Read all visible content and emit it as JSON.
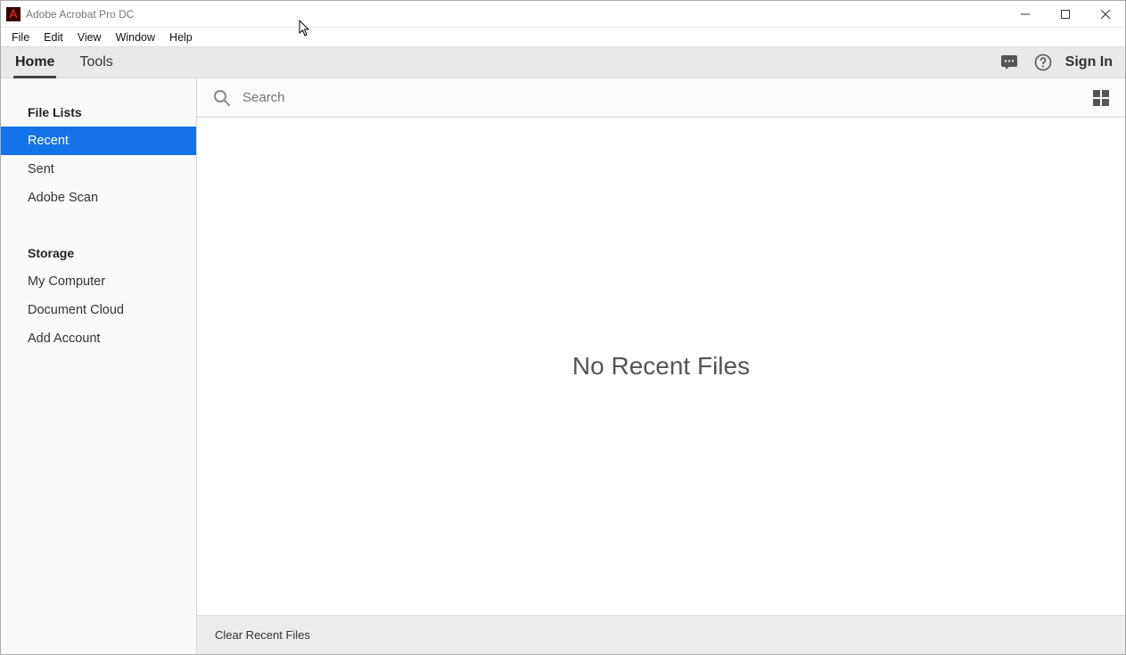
{
  "window": {
    "title": "Adobe Acrobat Pro DC"
  },
  "menubar": {
    "file": "File",
    "edit": "Edit",
    "view": "View",
    "window": "Window",
    "help": "Help"
  },
  "tabs": {
    "home": "Home",
    "tools": "Tools",
    "sign_in": "Sign In"
  },
  "sidebar": {
    "file_lists_header": "File Lists",
    "recent": "Recent",
    "sent": "Sent",
    "adobe_scan": "Adobe Scan",
    "storage_header": "Storage",
    "my_computer": "My Computer",
    "document_cloud": "Document Cloud",
    "add_account": "Add Account"
  },
  "search": {
    "placeholder": "Search"
  },
  "main": {
    "empty_message": "No Recent Files"
  },
  "footer": {
    "clear_recent": "Clear Recent Files"
  }
}
